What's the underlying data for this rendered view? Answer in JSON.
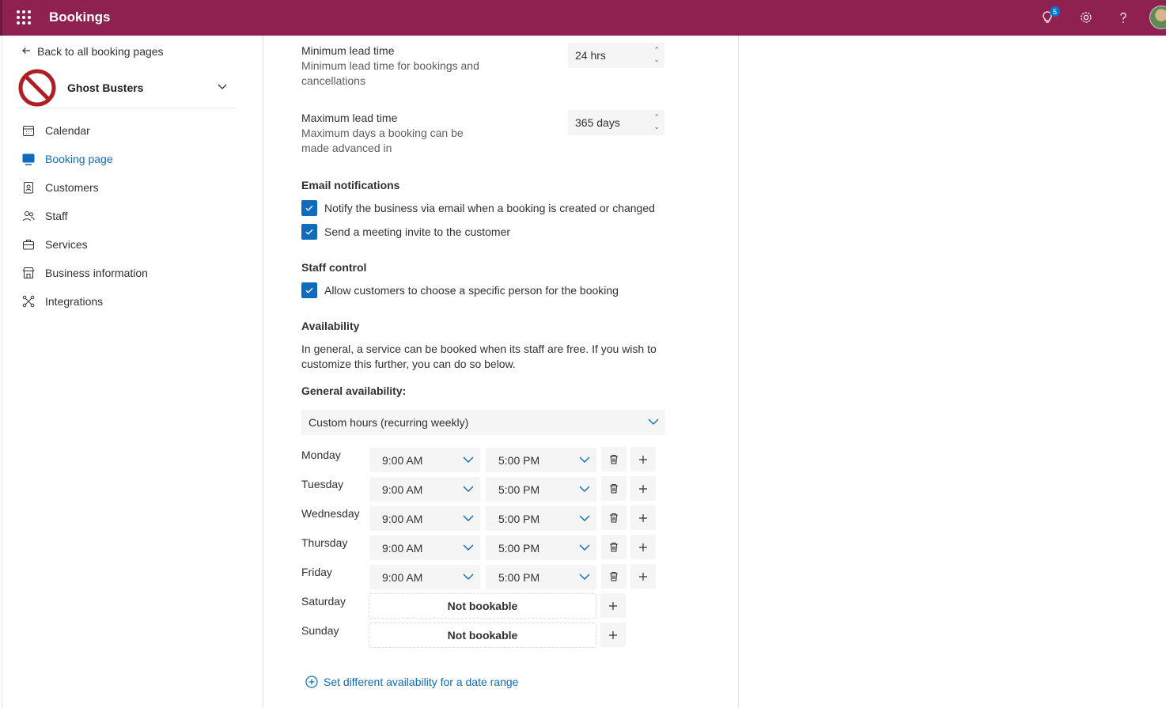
{
  "app": {
    "title": "Bookings",
    "notification_count": "5"
  },
  "sidebar": {
    "back_label": "Back to all booking pages",
    "business_name": "Ghost Busters",
    "items": [
      {
        "label": "Calendar",
        "icon": "calendar-icon",
        "active": false
      },
      {
        "label": "Booking page",
        "icon": "booking-page-icon",
        "active": true
      },
      {
        "label": "Customers",
        "icon": "customers-icon",
        "active": false
      },
      {
        "label": "Staff",
        "icon": "staff-icon",
        "active": false
      },
      {
        "label": "Services",
        "icon": "services-icon",
        "active": false
      },
      {
        "label": "Business information",
        "icon": "business-icon",
        "active": false
      },
      {
        "label": "Integrations",
        "icon": "integrations-icon",
        "active": false
      }
    ]
  },
  "lead_time": {
    "min_label": "Minimum lead time",
    "min_desc": "Minimum lead time for bookings and cancellations",
    "min_value": "24 hrs",
    "max_label": "Maximum lead time",
    "max_desc": "Maximum days a booking can be made advanced in",
    "max_value": "365 days"
  },
  "email": {
    "title": "Email notifications",
    "notify_business": "Notify the business via email when a booking is created or changed",
    "send_invite": "Send a meeting invite to the customer"
  },
  "staff_control": {
    "title": "Staff control",
    "allow_choose": "Allow customers to choose a specific person for the booking"
  },
  "availability": {
    "title": "Availability",
    "description": "In general, a service can be booked when its staff are free. If you wish to customize this further, you can do so below.",
    "general_label": "General availability:",
    "selected_option": "Custom hours (recurring weekly)",
    "days": [
      {
        "day": "Monday",
        "start": "9:00 AM",
        "end": "5:00 PM"
      },
      {
        "day": "Tuesday",
        "start": "9:00 AM",
        "end": "5:00 PM"
      },
      {
        "day": "Wednesday",
        "start": "9:00 AM",
        "end": "5:00 PM"
      },
      {
        "day": "Thursday",
        "start": "9:00 AM",
        "end": "5:00 PM"
      },
      {
        "day": "Friday",
        "start": "9:00 AM",
        "end": "5:00 PM"
      }
    ],
    "closed_days": [
      {
        "day": "Saturday",
        "status": "Not bookable"
      },
      {
        "day": "Sunday",
        "status": "Not bookable"
      }
    ],
    "date_range_link": "Set different availability for a date range"
  },
  "colors": {
    "brand": "#8e2150",
    "accent": "#0f6cbd"
  }
}
